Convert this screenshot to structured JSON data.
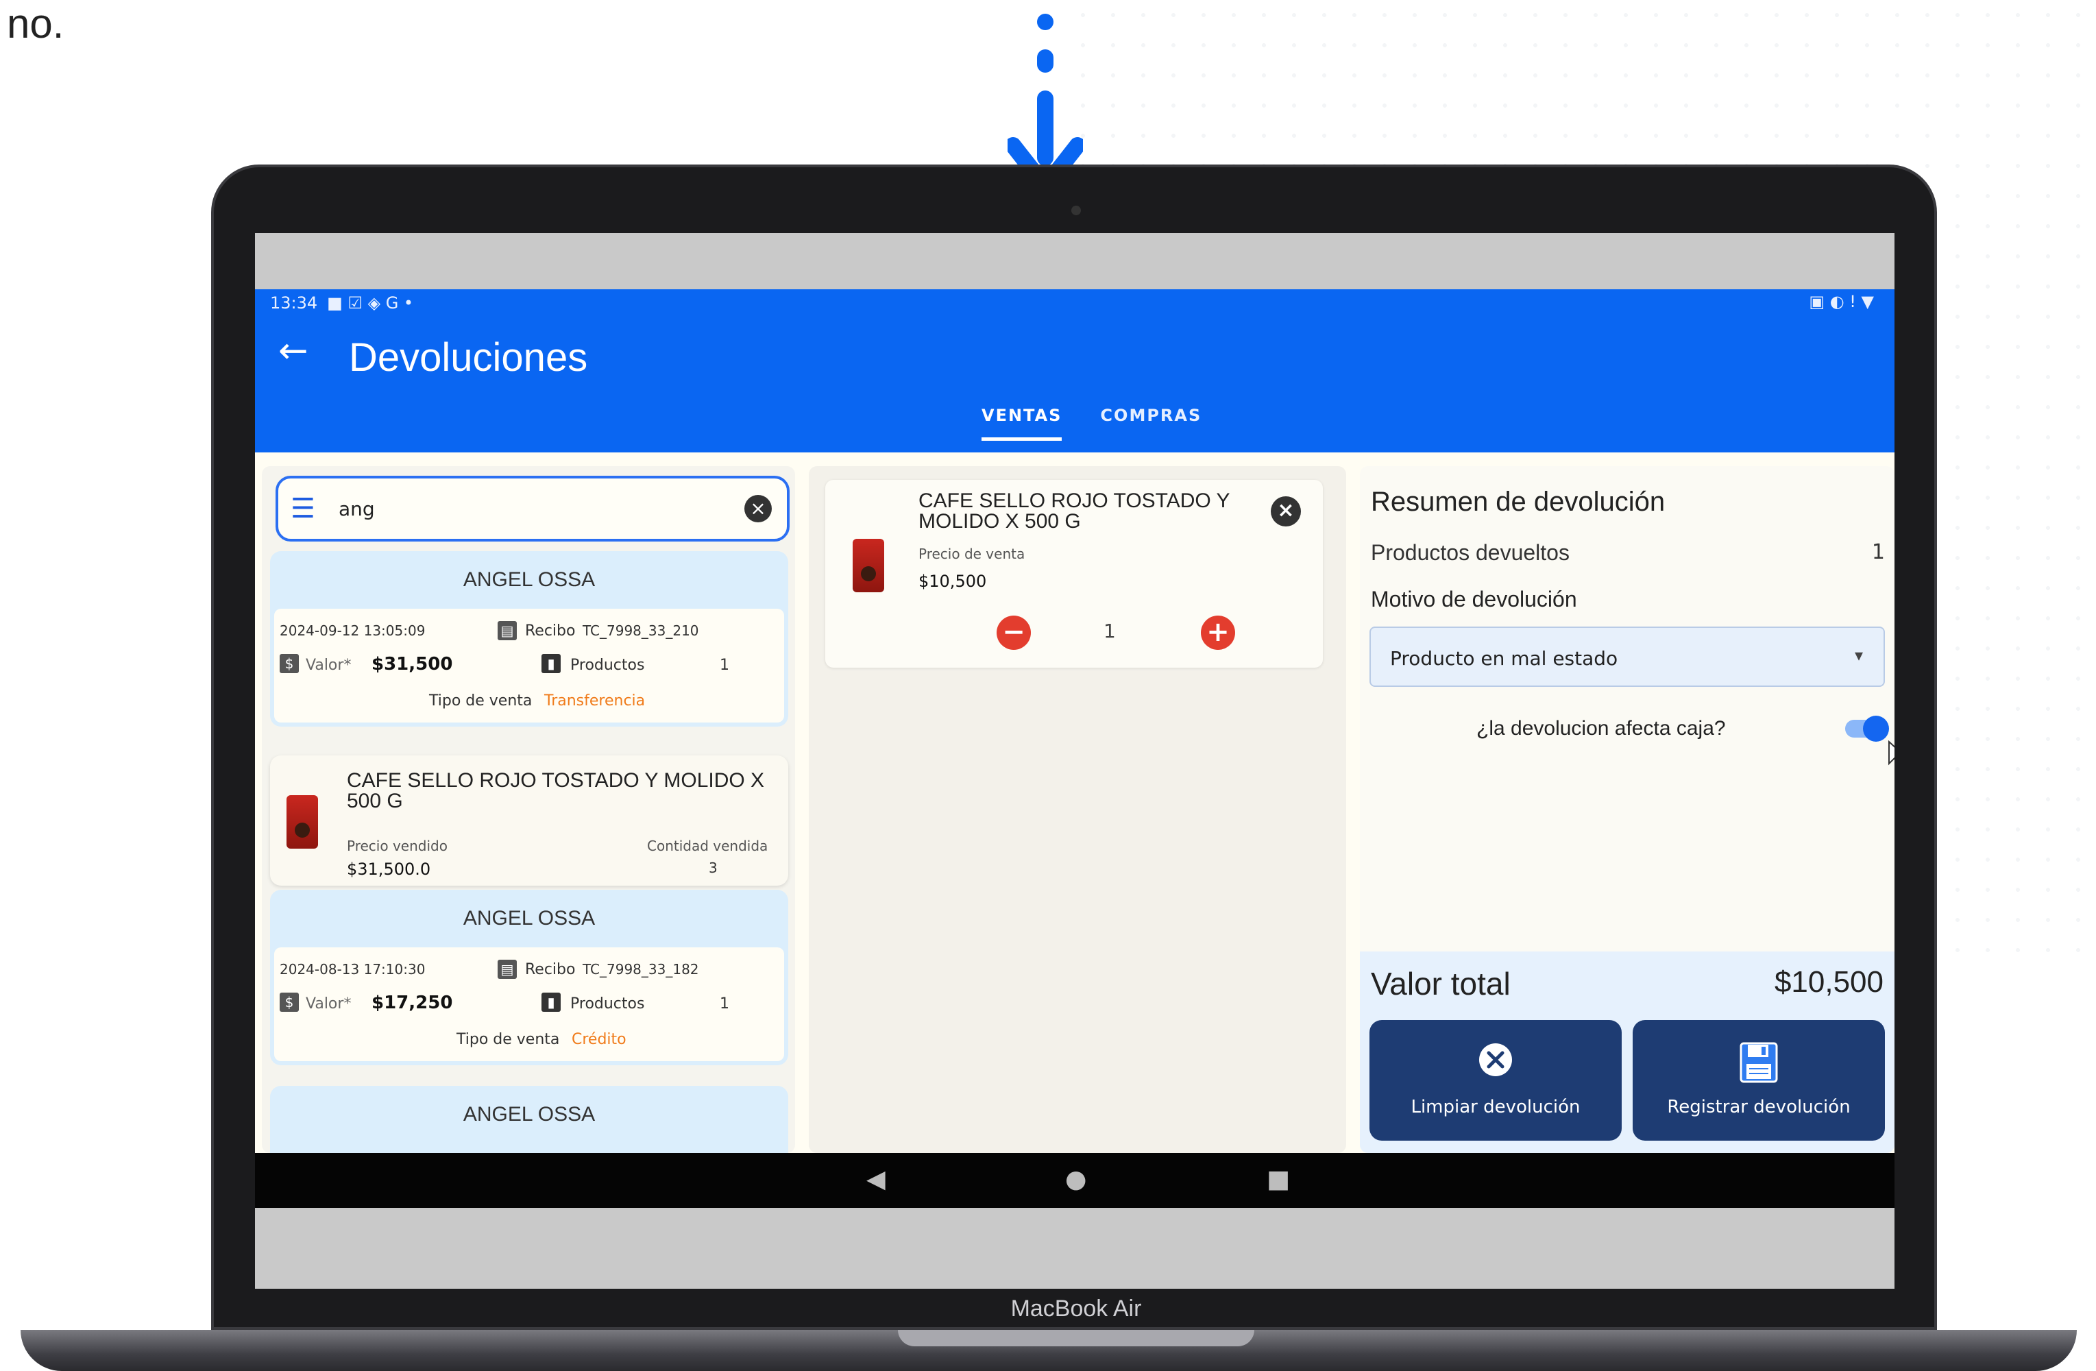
{
  "caption": "o no.",
  "device": {
    "brand": "MacBook Air"
  },
  "status_bar": {
    "time": "13:34",
    "left_icons": "■ ☑ ◈ G •",
    "right_icons": "▣ ◐ ! ▼"
  },
  "app": {
    "title": "Devoluciones",
    "accent": "#0a66f2",
    "tabs": [
      {
        "label": "VENTAS",
        "active": true
      },
      {
        "label": "COMPRAS",
        "active": false
      }
    ]
  },
  "search": {
    "value": "ang"
  },
  "sales_list": [
    {
      "customer": "ANGEL OSSA",
      "datetime": "2024-09-12 13:05:09",
      "receipt_label": "Recibo",
      "receipt": "TC_7998_33_210",
      "value_label": "Valor*",
      "value": "$31,500",
      "products_label": "Productos",
      "products": "1",
      "sale_type_label": "Tipo de venta",
      "sale_type": "Transferencia"
    },
    {
      "customer": "ANGEL OSSA",
      "datetime": "2024-08-13 17:10:30",
      "receipt_label": "Recibo",
      "receipt": "TC_7998_33_182",
      "value_label": "Valor*",
      "value": "$17,250",
      "products_label": "Productos",
      "products": "1",
      "sale_type_label": "Tipo de venta",
      "sale_type": "Crédito"
    },
    {
      "customer": "ANGEL OSSA"
    }
  ],
  "sold_product": {
    "name": "CAFE SELLO ROJO TOSTADO Y MOLIDO X 500 G",
    "price_label": "Precio vendido",
    "price": "$31,500.0",
    "qty_label": "Contidad vendida",
    "qty": "3"
  },
  "return_item": {
    "name": "CAFE SELLO ROJO TOSTADO Y MOLIDO X 500 G",
    "price_label": "Precio de venta",
    "price": "$10,500",
    "quantity": "1"
  },
  "summary": {
    "title": "Resumen de devolución",
    "returned_label": "Productos devueltos",
    "returned_count": "1",
    "reason_label": "Motivo de devolución",
    "reason_value": "Producto en mal estado",
    "affects_cash_label": "¿la devolucion afecta caja?",
    "affects_cash": true,
    "total_label": "Valor total",
    "total_value": "$10,500",
    "clear_button": "Limpiar devolución",
    "register_button": "Registrar devolución"
  }
}
